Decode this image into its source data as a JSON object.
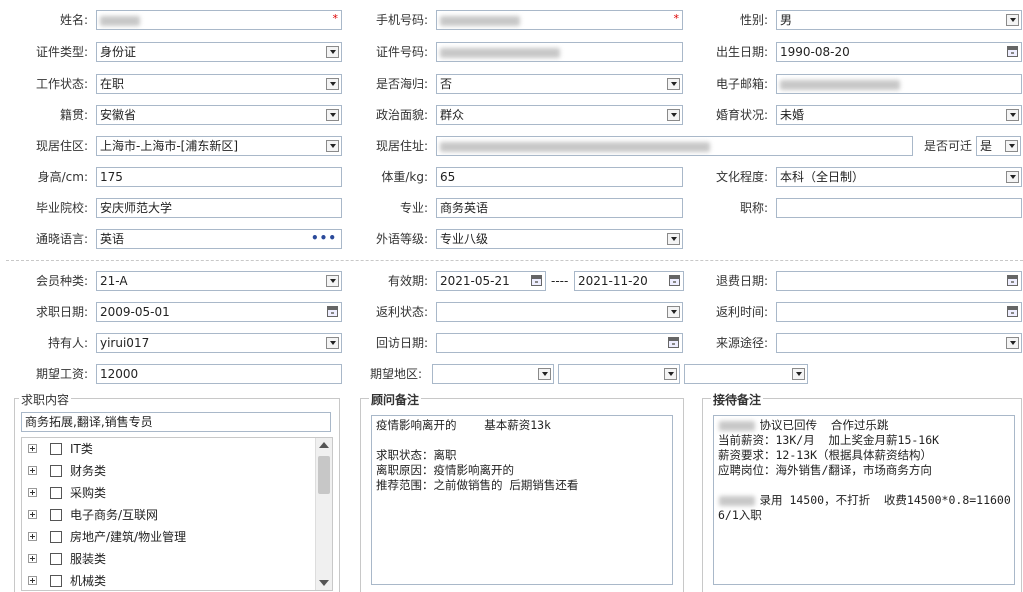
{
  "form": {
    "name_label": "姓名:",
    "phone_label": "手机号码:",
    "gender_label": "性别:",
    "gender_value": "男",
    "idtype_label": "证件类型:",
    "idtype_value": "身份证",
    "idno_label": "证件号码:",
    "birth_label": "出生日期:",
    "birth_value": "1990-08-20",
    "work_label": "工作状态:",
    "work_value": "在职",
    "overseas_label": "是否海归:",
    "overseas_value": "否",
    "email_label": "电子邮箱:",
    "native_label": "籍贯:",
    "native_value": "安徽省",
    "political_label": "政治面貌:",
    "political_value": "群众",
    "marital_label": "婚育状况:",
    "marital_value": "未婚",
    "region_label": "现居住区:",
    "region_value": "上海市-上海市-[浦东新区]",
    "address_label": "现居住址:",
    "relocate_label": "是否可迁",
    "relocate_value": "是",
    "height_label": "身高/cm:",
    "height_value": "175",
    "weight_label": "体重/kg:",
    "weight_value": "65",
    "education_label": "文化程度:",
    "education_value": "本科（全日制）",
    "school_label": "毕业院校:",
    "school_value": "安庆师范大学",
    "major_label": "专业:",
    "major_value": "商务英语",
    "title_label": "职称:",
    "title_value": "",
    "language_label": "通晓语言:",
    "language_value": "英语",
    "language_more": "•••",
    "langlevel_label": "外语等级:",
    "langlevel_value": "专业八级"
  },
  "member": {
    "type_label": "会员种类:",
    "type_value": "21-A",
    "valid_label": "有效期:",
    "valid_from": "2021-05-21",
    "valid_sep": "----",
    "valid_to": "2021-11-20",
    "refund_date_label": "退费日期:",
    "refund_date_value": "",
    "job_date_label": "求职日期:",
    "job_date_value": "2009-05-01",
    "rebate_status_label": "返利状态:",
    "rebate_status_value": "",
    "rebate_time_label": "返利时间:",
    "rebate_time_value": "",
    "holder_label": "持有人:",
    "holder_value": "yirui017",
    "visit_date_label": "回访日期:",
    "visit_date_value": "",
    "source_label": "来源途径:",
    "source_value": "",
    "salary_label": "期望工资:",
    "salary_value": "12000",
    "area_label": "期望地区:"
  },
  "job_panel": {
    "title": "求职内容",
    "selected": "商务拓展,翻译,销售专员",
    "categories": [
      "IT类",
      "财务类",
      "采购类",
      "电子商务/互联网",
      "房地产/建筑/物业管理",
      "服装类",
      "机械类"
    ]
  },
  "advisor_notes": {
    "title": "顾问备注",
    "text": "疫情影响离开的    基本薪资13k\n\n求职状态：离职\n离职原因：疫情影响离开的\n推荐范围：之前做销售的 后期销售还看"
  },
  "reception_notes": {
    "title": "接待备注",
    "text": "      协议已回传  合作过乐跳\n当前薪资：13K/月  加上奖金月薪15-16K\n薪资要求：12-13K（根据具体薪资结构）\n应聘岗位：海外销售/翻译，市场商务方向\n\n      录用 14500，不打折  收费14500*0.8=11600\n6/1入职"
  },
  "icons": {
    "dropdown": "chevron-down-icon",
    "calendar": "calendar-icon",
    "expand": "plus-expand-icon",
    "checkbox": "checkbox-icon"
  },
  "colors": {
    "required": "#dd0000",
    "border": "#a9b8c9"
  }
}
